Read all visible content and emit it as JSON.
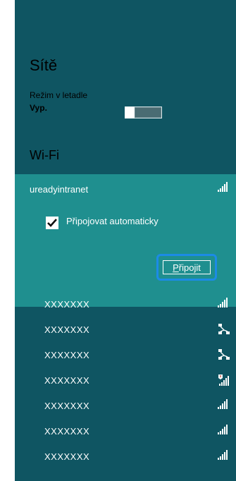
{
  "panel": {
    "title": "Sítě",
    "airplane_mode": {
      "label": "Režim v letadle",
      "value": "Vyp."
    },
    "wifi_heading": "Wi-Fi",
    "selected_network": {
      "name": "ureadyintranet",
      "auto_connect_label": "Připojovat automaticky",
      "auto_connect_checked": true,
      "connect_button": "Připojit",
      "connect_button_accesskey": "P"
    },
    "networks": [
      {
        "name": "XXXXXXX",
        "icon": "wifi-signal-icon"
      },
      {
        "name": "XXXXXXX",
        "icon": "wifi-shared-icon"
      },
      {
        "name": "XXXXXXX",
        "icon": "wifi-shared-icon"
      },
      {
        "name": "XXXXXXX",
        "icon": "wifi-secured-warning-icon"
      },
      {
        "name": "XXXXXXX",
        "icon": "wifi-signal-icon"
      },
      {
        "name": "XXXXXXX",
        "icon": "wifi-signal-icon"
      },
      {
        "name": "XXXXXXX",
        "icon": "wifi-signal-icon"
      }
    ]
  },
  "colors": {
    "panel_bg": "#0f5562",
    "selected_bg": "#1f8f8f",
    "focus_ring": "#1c8be6"
  }
}
